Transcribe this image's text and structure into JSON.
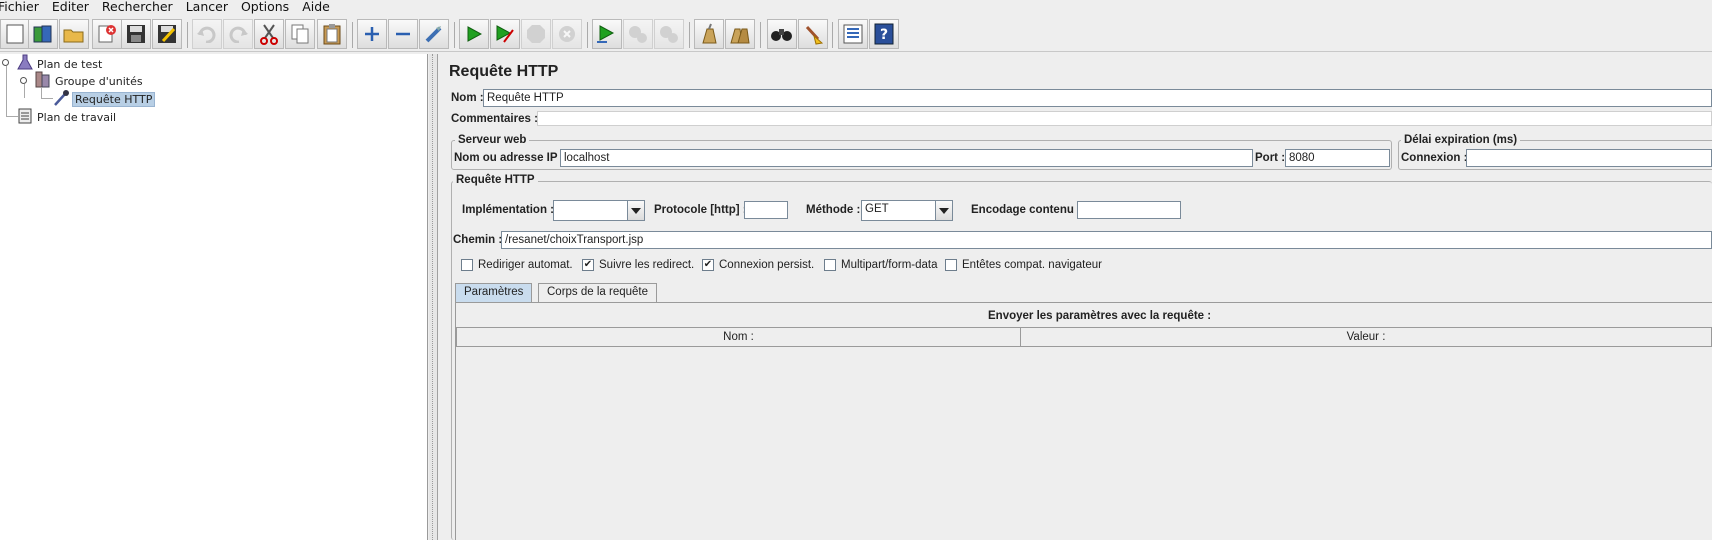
{
  "menu": [
    "Fichier",
    "Editer",
    "Rechercher",
    "Lancer",
    "Options",
    "Aide"
  ],
  "toolbar": [
    {
      "icon": "new-icon"
    },
    {
      "icon": "templates-icon"
    },
    {
      "icon": "open-icon"
    },
    {
      "icon": "close-icon"
    },
    {
      "icon": "save-icon"
    },
    {
      "icon": "save-as-icon"
    },
    {
      "icon": "undo-icon"
    },
    {
      "icon": "redo-icon"
    },
    {
      "icon": "cut-icon"
    },
    {
      "icon": "copy-icon"
    },
    {
      "icon": "paste-icon"
    },
    {
      "icon": "expand-icon"
    },
    {
      "icon": "collapse-icon"
    },
    {
      "icon": "toggle-icon"
    },
    {
      "icon": "start-icon"
    },
    {
      "icon": "start-no-pause-icon"
    },
    {
      "icon": "stop-icon"
    },
    {
      "icon": "shutdown-icon"
    },
    {
      "icon": "remote-start-icon"
    },
    {
      "icon": "remote-stop-icon"
    },
    {
      "icon": "remote-shutdown-icon"
    },
    {
      "icon": "clear-icon"
    },
    {
      "icon": "clear-all-icon"
    },
    {
      "icon": "search-icon"
    },
    {
      "icon": "reset-search-icon"
    },
    {
      "icon": "function-helper-icon"
    },
    {
      "icon": "help-icon"
    }
  ],
  "tree": {
    "test_plan": "Plan de test",
    "thread_group": "Groupe d'unités",
    "http_request": "Requête HTTP",
    "workbench": "Plan de travail"
  },
  "panel": {
    "title": "Requête HTTP",
    "name_label": "Nom :",
    "name_value": "Requête HTTP",
    "comments_label": "Commentaires :",
    "web_server": {
      "title": "Serveur web",
      "host_label": "Nom ou adresse IP :",
      "host_value": "localhost",
      "port_label": "Port :",
      "port_value": "8080"
    },
    "timeout": {
      "title": "Délai expiration (ms)",
      "connect_label": "Connexion :"
    },
    "http_request": {
      "title": "Requête HTTP",
      "impl_label": "Implémentation :",
      "impl_value": "",
      "protocol_label": "Protocole [http] :",
      "protocol_value": "",
      "method_label": "Méthode :",
      "method_value": "GET",
      "encoding_label": "Encodage contenu :",
      "encoding_value": "",
      "path_label": "Chemin :",
      "path_value": "/resanet/choixTransport.jsp"
    },
    "options": [
      {
        "label": "Rediriger automat.",
        "checked": false
      },
      {
        "label": "Suivre les redirect.",
        "checked": true
      },
      {
        "label": "Connexion persist.",
        "checked": true
      },
      {
        "label": "Multipart/form-data",
        "checked": false
      },
      {
        "label": "Entêtes compat. navigateur",
        "checked": false
      }
    ],
    "tabs": [
      "Paramètres",
      "Corps de la requête"
    ],
    "params": {
      "title": "Envoyer les paramètres avec la requête :",
      "col_name": "Nom :",
      "col_value": "Valeur :"
    }
  }
}
